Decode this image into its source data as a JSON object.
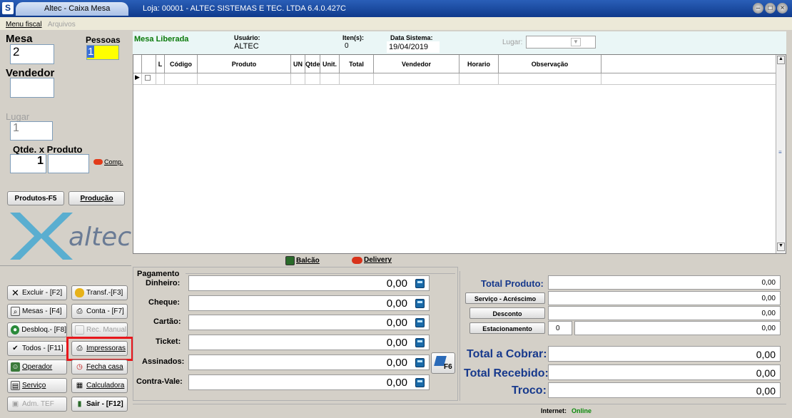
{
  "window": {
    "app_tab": "Altec - Caixa Mesa",
    "loja": "Loja: 00001 - ALTEC SISTEMAS E TEC. LTDA  6.4.0.427C",
    "sys_icon": "S"
  },
  "menu": {
    "fiscal": "Menu fiscal",
    "arquivos": "Arquivos"
  },
  "left": {
    "mesa_label": "Mesa",
    "mesa_value": "2",
    "pessoas_label": "Pessoas",
    "pessoas_value": "1",
    "vendedor_label": "Vendedor",
    "lugar_label": "Lugar",
    "lugar_value": "1",
    "qtde_label": "Qtde.  x Produto",
    "qtde_value": "1",
    "comp_label": "Comp.",
    "produtos_btn": "Produtos-F5",
    "producao_btn": "Produção",
    "logo_text": "altec"
  },
  "buttons": {
    "excluir": "Excluir - [F2]",
    "transf": "Transf.-[F3]",
    "mesas": "Mesas - [F4]",
    "conta": "Conta - [F7]",
    "desbloq": "Desbloq.- [F8]",
    "rec_manual": "Rec. Manual",
    "todos": "Todos - [F11]",
    "impressoras": "Impressoras",
    "operador": "Operador",
    "fecha_casa": "Fecha casa",
    "servico": "Serviço",
    "calculadora": "Calculadora",
    "adm_tef": "Adm. TEF",
    "sair": "Sair - [F12]"
  },
  "info": {
    "status": "Mesa Liberada",
    "usuario_label": "Usuário:",
    "usuario_value": "ALTEC",
    "itens_label": "Iten(s):",
    "itens_value": "0",
    "data_label": "Data Sistema:",
    "data_value": "19/04/2019",
    "lugar_label": "Lugar:"
  },
  "grid": {
    "columns": [
      "",
      "",
      "L",
      "Código",
      "Produto",
      "UN",
      "Qtde",
      "Unit.",
      "Total",
      "Vendedor",
      "Horario",
      "Observação"
    ]
  },
  "midbar": {
    "balcao": "Balcão",
    "delivery": "Delivery"
  },
  "payment": {
    "title": "Pagamento",
    "rows": [
      {
        "label": "Dinheiro:",
        "value": "0,00"
      },
      {
        "label": "Cheque:",
        "value": "0,00"
      },
      {
        "label": "Cartão:",
        "value": "0,00"
      },
      {
        "label": "Ticket:",
        "value": "0,00"
      },
      {
        "label": "Assinados:",
        "value": "0,00"
      },
      {
        "label": "Contra-Vale:",
        "value": "0,00"
      }
    ],
    "f6": "F6"
  },
  "totals": {
    "total_produto_label": "Total Produto:",
    "total_produto": "0,00",
    "servico_btn": "Serviço - Acréscimo",
    "servico": "0,00",
    "desconto_btn": "Desconto",
    "desconto": "0,00",
    "estacionamento_btn": "Estacionamento",
    "estac_qtd": "0",
    "estacionamento": "0,00",
    "total_cobrar_label": "Total a Cobrar:",
    "total_cobrar": "0,00",
    "total_recebido_label": "Total Recebido:",
    "total_recebido": "0,00",
    "troco_label": "Troco:",
    "troco": "0,00"
  },
  "status": {
    "internet_label": "Internet:",
    "internet_value": "Online"
  },
  "colors": {
    "highlight": "#e8161b",
    "pessoas_bg": "#ffff00",
    "status_green": "#0a7a0a",
    "total_blue": "#17398c"
  }
}
